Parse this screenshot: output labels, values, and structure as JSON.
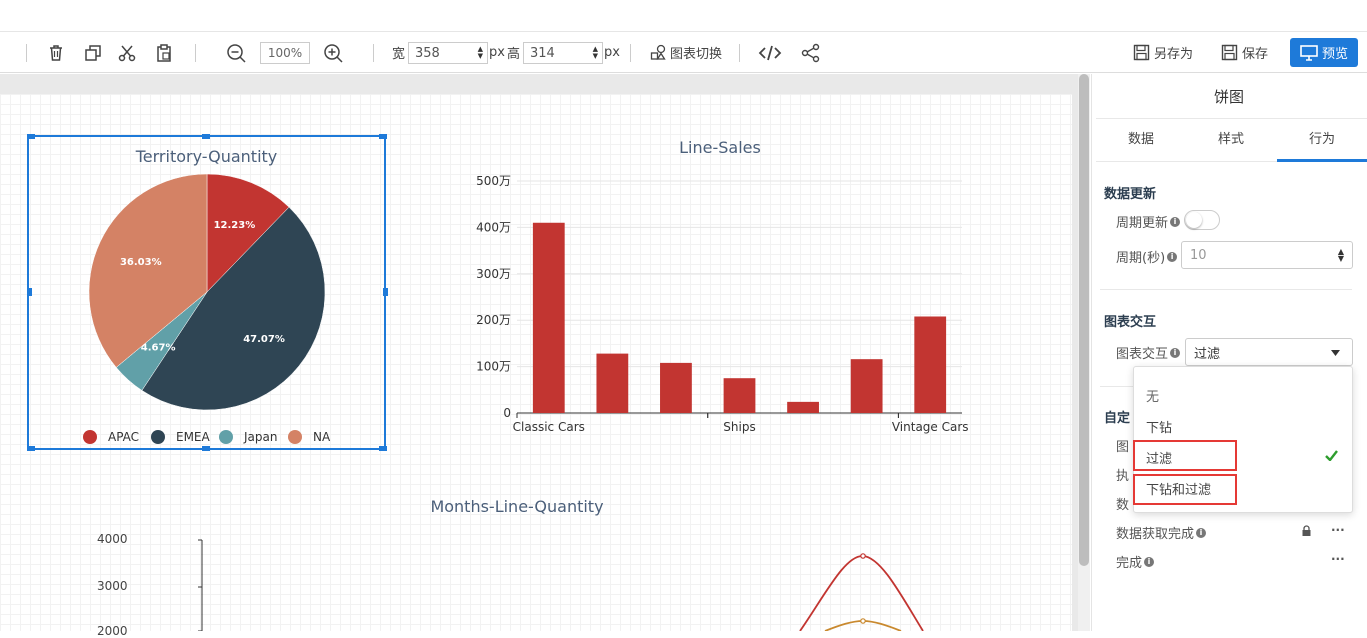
{
  "toolbar": {
    "zoom_value": "100%",
    "width_label": "宽",
    "width_value": "358",
    "px1": "px",
    "height_label": "高",
    "height_value": "314",
    "px2": "px",
    "chart_switch": "图表切换",
    "save_as": "另存为",
    "save": "保存",
    "preview": "预览"
  },
  "panel": {
    "title": "饼图",
    "tabs": [
      "数据",
      "样式",
      "行为"
    ],
    "active_tab": 2,
    "data_update": {
      "title": "数据更新",
      "period_update_label": "周期更新",
      "period_seconds_label": "周期(秒)",
      "period_seconds_value": "10"
    },
    "chart_interaction": {
      "title": "图表交互",
      "label": "图表交互",
      "selected": "过滤",
      "options": [
        "无",
        "下钻",
        "过滤",
        "下钻和过滤"
      ]
    },
    "custom_events": {
      "title_partial": "自定",
      "rows_partial": [
        "图",
        "执",
        "数"
      ],
      "data_fetch_complete": "数据获取完成",
      "complete": "完成",
      "more": "..."
    }
  },
  "colors": {
    "accent": "#1e7ad9",
    "apac": "#c23531",
    "emea": "#2f4554",
    "japan": "#61a0a8",
    "na": "#d48265",
    "highlight": "#e53935",
    "check": "#2e9d2e"
  },
  "chart_data": [
    {
      "type": "pie",
      "title": "Territory-Quantity",
      "labels": [
        "APAC",
        "EMEA",
        "Japan",
        "NA"
      ],
      "values": [
        12.23,
        47.07,
        4.67,
        36.03
      ],
      "value_labels": [
        "12.23%",
        "47.07%",
        "4.67%",
        "36.03%"
      ],
      "legend": "bottom"
    },
    {
      "type": "bar",
      "title": "Line-Sales",
      "categories": [
        "Classic Cars",
        "",
        "",
        "Ships",
        "",
        "",
        "Vintage Cars"
      ],
      "tick_labels": [
        "Classic Cars",
        "Ships",
        "Vintage Cars"
      ],
      "values": [
        410,
        128,
        108,
        75,
        24,
        116,
        208
      ],
      "ylim": [
        0,
        500
      ],
      "y_ticks": [
        "0",
        "100万",
        "200万",
        "300万",
        "400万",
        "500万"
      ],
      "grid": true
    },
    {
      "type": "line",
      "title": "Months-Line-Quantity",
      "y_ticks": [
        "4000",
        "3000",
        "2000"
      ]
    }
  ]
}
